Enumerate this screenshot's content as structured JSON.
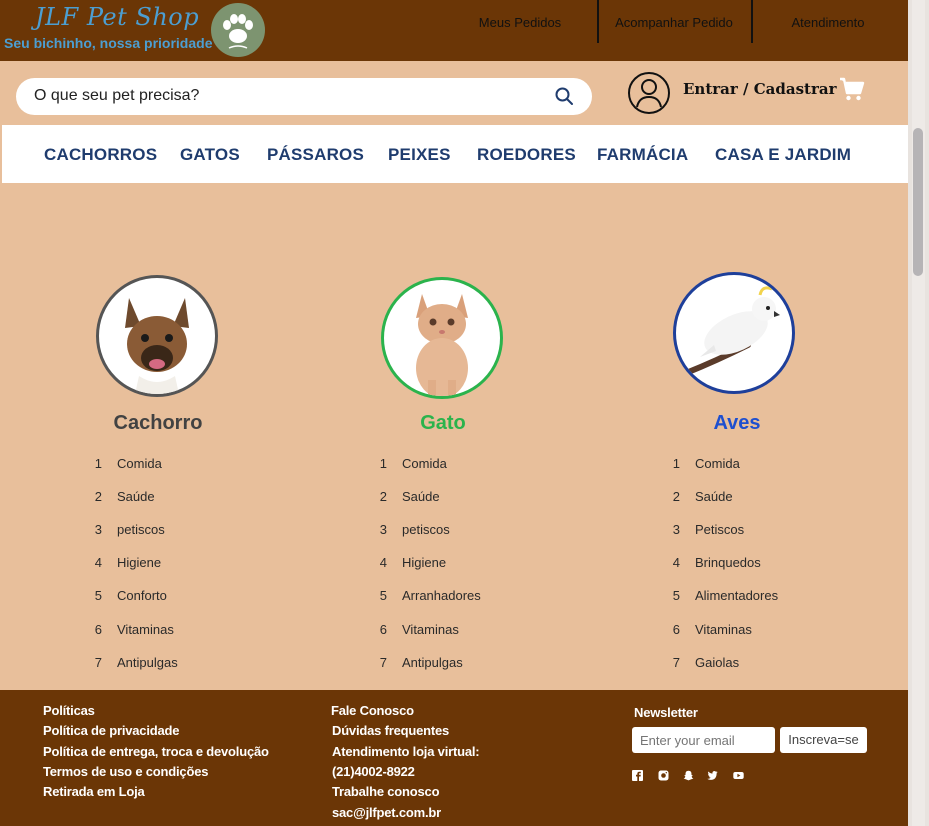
{
  "header": {
    "brand": "JLF Pet Shop",
    "tagline": "Seu bichinho, nossa prioridade",
    "nav": [
      "Meus Pedidos",
      "Acompanhar Pedido",
      "Atendimento"
    ]
  },
  "search": {
    "placeholder": "O que seu pet precisa?",
    "login_label": "Entrar / Cadastrar"
  },
  "categories": [
    "CACHORROS",
    "GATOS",
    "PÁSSAROS",
    "PEIXES",
    "ROEDORES",
    "FARMÁCIA",
    "CASA E JARDIM"
  ],
  "colors": {
    "header_bg": "#6b3606",
    "page_bg": "#e8bf9b",
    "category_text": "#1f3c6e",
    "dog_title": "#424242",
    "cat_title": "#2bb34c",
    "bird_title": "#1e4fcf",
    "dog_ring": "#555555",
    "cat_ring": "#2bb34c",
    "bird_ring": "#1e3f9a"
  },
  "pets": [
    {
      "title": "Cachorro",
      "items": [
        {
          "num": "1",
          "label": "Comida"
        },
        {
          "num": "2",
          "label": "Saúde"
        },
        {
          "num": "3",
          "label": "petiscos"
        },
        {
          "num": "4",
          "label": "Higiene"
        },
        {
          "num": "5",
          "label": "Conforto"
        },
        {
          "num": "6",
          "label": "Vitaminas"
        },
        {
          "num": "7",
          "label": "Antipulgas"
        }
      ]
    },
    {
      "title": "Gato",
      "items": [
        {
          "num": "1",
          "label": "Comida"
        },
        {
          "num": "2",
          "label": "Saúde"
        },
        {
          "num": "3",
          "label": "petiscos"
        },
        {
          "num": "4",
          "label": "Higiene"
        },
        {
          "num": "5",
          "label": "Arranhadores"
        },
        {
          "num": "6",
          "label": "Vitaminas"
        },
        {
          "num": "7",
          "label": "Antipulgas"
        }
      ]
    },
    {
      "title": "Aves",
      "items": [
        {
          "num": "1",
          "label": "Comida"
        },
        {
          "num": "2",
          "label": "Saúde"
        },
        {
          "num": "3",
          "label": "Petiscos"
        },
        {
          "num": "4",
          "label": "Brinquedos"
        },
        {
          "num": "5",
          "label": "Alimentadores"
        },
        {
          "num": "6",
          "label": "Vitaminas"
        },
        {
          "num": "7",
          "label": "Gaiolas"
        }
      ]
    }
  ],
  "footer": {
    "col1": [
      "Políticas",
      "Política de privacidade",
      "Política de entrega, troca e devolução",
      "Termos de uso e condições",
      "Retirada em Loja"
    ],
    "col2": [
      "Fale Conosco",
      "Dúvidas frequentes",
      "Atendimento loja virtual:",
      "(21)4002-8922",
      "Trabalhe conosco",
      "sac@jlfpet.com.br"
    ],
    "newsletter_title": "Newsletter",
    "newsletter_placeholder": "Enter your email",
    "newsletter_button": "Inscreva=se",
    "social_icons": [
      "facebook-icon",
      "instagram-icon",
      "snapchat-icon",
      "twitter-icon",
      "youtube-icon"
    ]
  }
}
